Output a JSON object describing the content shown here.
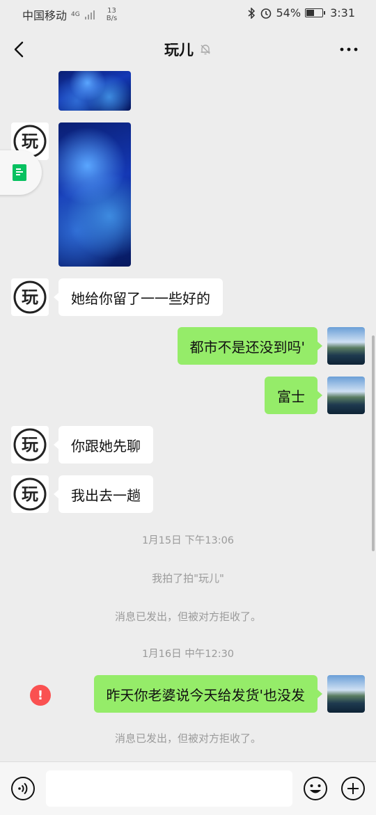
{
  "status_bar": {
    "carrier": "中国移动",
    "network": "4G",
    "speed_value": "13",
    "speed_unit": "B/s",
    "battery": "54%",
    "battery_level": 0.54,
    "time": "3:31",
    "icons": [
      "bluetooth-icon",
      "alarm-icon",
      "battery-icon",
      "signal-icon"
    ]
  },
  "header": {
    "title": "玩儿",
    "icons": [
      "back-arrow-icon",
      "mute-bell-icon",
      "more-dots-icon"
    ]
  },
  "messages": [
    {
      "type": "image",
      "side": "in"
    },
    {
      "type": "image",
      "side": "in"
    },
    {
      "type": "text",
      "side": "in",
      "text": "她给你留了一一些好的"
    },
    {
      "type": "text",
      "side": "out",
      "text": "都市不是还没到吗'"
    },
    {
      "type": "text",
      "side": "out",
      "text": "富士"
    },
    {
      "type": "text",
      "side": "in",
      "text": "你跟她先聊"
    },
    {
      "type": "text",
      "side": "in",
      "text": "我出去一趟"
    },
    {
      "type": "time",
      "text": "1月15日 下午13:06"
    },
    {
      "type": "system",
      "text": "我拍了拍\"玩儿\""
    },
    {
      "type": "system",
      "text": "消息已发出，但被对方拒收了。"
    },
    {
      "type": "time",
      "text": "1月16日 中午12:30"
    },
    {
      "type": "text",
      "side": "out",
      "text": "昨天你老婆说今天给发货'也没发",
      "failed": true
    },
    {
      "type": "system",
      "text": "消息已发出，但被对方拒收了。"
    }
  ],
  "contact_avatar_glyph": "玩",
  "input_bar": {
    "placeholder": "",
    "icons": [
      "voice-icon",
      "emoji-icon",
      "plus-icon"
    ]
  },
  "colors": {
    "background": "#ededed",
    "out_bubble": "#95ec69",
    "in_bubble": "#ffffff",
    "error": "#fa5151"
  }
}
